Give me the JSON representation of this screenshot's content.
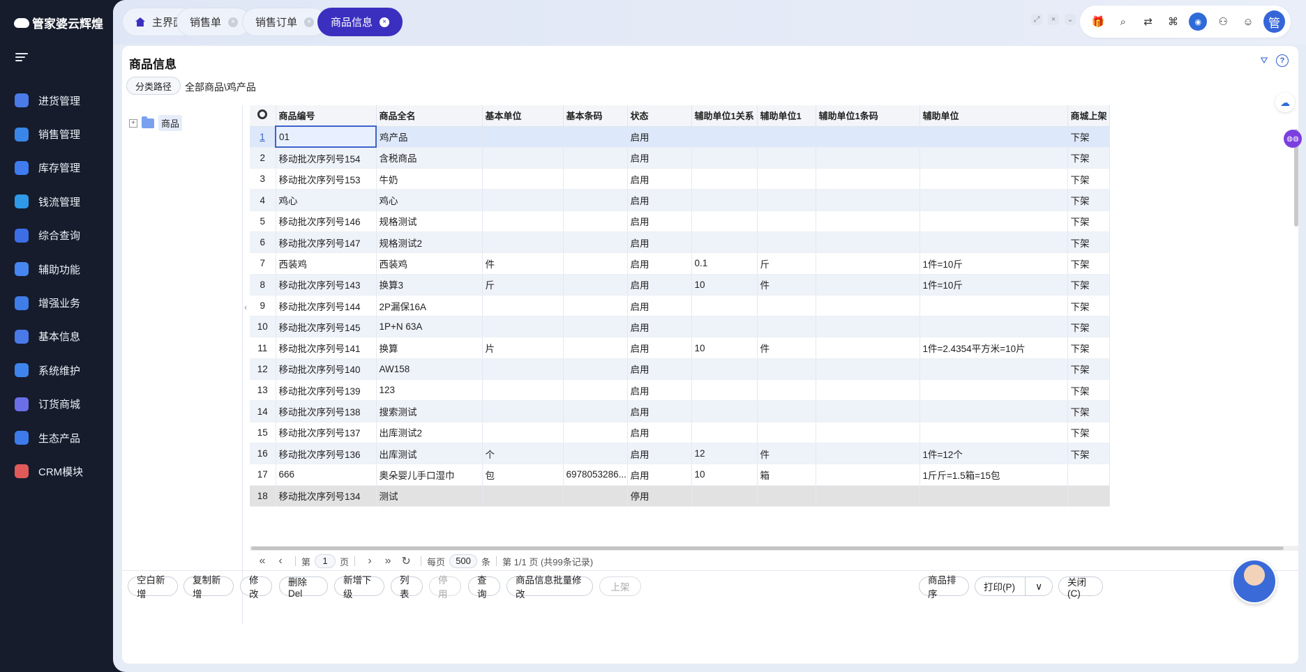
{
  "app": {
    "logo_text": "管家婆云辉煌"
  },
  "sidebar": {
    "items": [
      {
        "label": "进货管理",
        "icon": "purchase-icon",
        "color": "#4a7be8"
      },
      {
        "label": "销售管理",
        "icon": "sales-icon",
        "color": "#3a86e8"
      },
      {
        "label": "库存管理",
        "icon": "inventory-icon",
        "color": "#3e7cf0"
      },
      {
        "label": "钱流管理",
        "icon": "money-flow-icon",
        "color": "#2f9be8"
      },
      {
        "label": "综合查询",
        "icon": "query-icon",
        "color": "#3c6fe6"
      },
      {
        "label": "辅助功能",
        "icon": "assist-icon",
        "color": "#4786f0"
      },
      {
        "label": "增强业务",
        "icon": "enhanced-icon",
        "color": "#3f7de8"
      },
      {
        "label": "基本信息",
        "icon": "basic-info-icon",
        "color": "#4a79e8"
      },
      {
        "label": "系统维护",
        "icon": "system-icon",
        "color": "#3f84ec"
      },
      {
        "label": "订货商城",
        "icon": "mall-icon",
        "color": "#6a6fe8"
      },
      {
        "label": "生态产品",
        "icon": "eco-icon",
        "color": "#3d7bea"
      },
      {
        "label": "CRM模块",
        "icon": "crm-icon",
        "color": "#e05a5a"
      }
    ]
  },
  "tabs": [
    {
      "label": "主界面",
      "closable": false,
      "active": false
    },
    {
      "label": "销售单",
      "closable": true,
      "active": false
    },
    {
      "label": "销售订单",
      "closable": true,
      "active": false
    },
    {
      "label": "商品信息",
      "closable": true,
      "active": true
    }
  ],
  "header": {
    "user_avatar_text": "管"
  },
  "page": {
    "title": "商品信息",
    "category_button": "分类路径",
    "category_path": "全部商品\\鸡产品",
    "tree_root": "商品"
  },
  "table": {
    "columns": [
      "商品编号",
      "商品全名",
      "基本单位",
      "基本条码",
      "状态",
      "辅助单位1关系",
      "辅助单位1",
      "辅助单位1条码",
      "辅助单位",
      "商城上架"
    ],
    "rows": [
      [
        "1",
        "01",
        "鸡产品",
        "",
        "",
        "启用",
        "",
        "",
        "",
        "",
        "下架"
      ],
      [
        "2",
        "移动批次序列号154",
        "含税商品",
        "",
        "",
        "启用",
        "",
        "",
        "",
        "",
        "下架"
      ],
      [
        "3",
        "移动批次序列号153",
        "牛奶",
        "",
        "",
        "启用",
        "",
        "",
        "",
        "",
        "下架"
      ],
      [
        "4",
        "鸡心",
        "鸡心",
        "",
        "",
        "启用",
        "",
        "",
        "",
        "",
        "下架"
      ],
      [
        "5",
        "移动批次序列号146",
        "规格测试",
        "",
        "",
        "启用",
        "",
        "",
        "",
        "",
        "下架"
      ],
      [
        "6",
        "移动批次序列号147",
        "规格测试2",
        "",
        "",
        "启用",
        "",
        "",
        "",
        "",
        "下架"
      ],
      [
        "7",
        "西装鸡",
        "西装鸡",
        "件",
        "",
        "启用",
        "0.1",
        "斤",
        "",
        "1件=10斤",
        "下架"
      ],
      [
        "8",
        "移动批次序列号143",
        "换算3",
        "斤",
        "",
        "启用",
        "10",
        "件",
        "",
        "1件=10斤",
        "下架"
      ],
      [
        "9",
        "移动批次序列号144",
        "2P漏保16A",
        "",
        "",
        "启用",
        "",
        "",
        "",
        "",
        "下架"
      ],
      [
        "10",
        "移动批次序列号145",
        "1P+N 63A",
        "",
        "",
        "启用",
        "",
        "",
        "",
        "",
        "下架"
      ],
      [
        "11",
        "移动批次序列号141",
        "换算",
        "片",
        "",
        "启用",
        "10",
        "件",
        "",
        "1件=2.4354平方米=10片",
        "下架"
      ],
      [
        "12",
        "移动批次序列号140",
        "AW158",
        "",
        "",
        "启用",
        "",
        "",
        "",
        "",
        "下架"
      ],
      [
        "13",
        "移动批次序列号139",
        "123",
        "",
        "",
        "启用",
        "",
        "",
        "",
        "",
        "下架"
      ],
      [
        "14",
        "移动批次序列号138",
        "搜索测试",
        "",
        "",
        "启用",
        "",
        "",
        "",
        "",
        "下架"
      ],
      [
        "15",
        "移动批次序列号137",
        "出库测试2",
        "",
        "",
        "启用",
        "",
        "",
        "",
        "",
        "下架"
      ],
      [
        "16",
        "移动批次序列号136",
        "出库测试",
        "个",
        "",
        "启用",
        "12",
        "件",
        "",
        "1件=12个",
        "下架"
      ],
      [
        "17",
        "666",
        "奥朵婴儿手口湿巾",
        "包",
        "6978053286...",
        "启用",
        "10",
        "箱",
        "",
        "1斤斤=1.5箱=15包",
        ""
      ],
      [
        "18",
        "移动批次序列号134",
        "测试",
        "",
        "",
        "停用",
        "",
        "",
        "",
        "",
        ""
      ]
    ]
  },
  "pager": {
    "page_prefix": "第",
    "page": "1",
    "page_suffix": "页",
    "per_page_label": "每页",
    "per_page": "500",
    "per_page_unit": "条",
    "summary": "第 1/1 页 (共99条记录)"
  },
  "buttons": {
    "blank_add": "空白新增",
    "copy_add": "复制新增",
    "edit": "修改",
    "delete": "删除Del",
    "add_child": "新增下级",
    "list": "列表",
    "disable": "停用",
    "query": "查询",
    "batch_edit": "商品信息批量修改",
    "shelve": "上架",
    "sort": "商品排序",
    "print": "打印(P)",
    "close": "关闭(C)"
  }
}
